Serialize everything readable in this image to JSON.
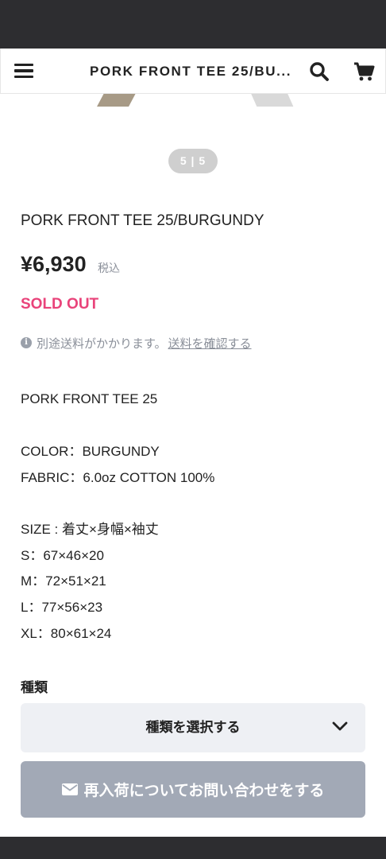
{
  "header": {
    "title": "PORK FRONT TEE 25/BU...",
    "menu_icon": "menu-icon",
    "search_icon": "search-icon",
    "cart_icon": "cart-icon"
  },
  "gallery": {
    "counter": "5 | 5"
  },
  "product": {
    "name": "PORK FRONT TEE 25/BURGUNDY",
    "price": "¥6,930",
    "tax_label": "税込",
    "status": "SOLD OUT",
    "status_color": "#e9437a"
  },
  "shipping": {
    "note": "別途送料がかかります。",
    "link": "送料を確認する"
  },
  "description": [
    "PORK FRONT TEE 25",
    "COLOR：BURGUNDY",
    "FABRIC：6.0oz COTTON 100%",
    "SIZE : 着丈×身幅×袖丈",
    "S：67×46×20",
    "M：72×51×21",
    "L：77×56×23",
    "XL：80×61×24"
  ],
  "variant": {
    "label": "種類",
    "placeholder": "種類を選択する"
  },
  "restock_button": {
    "label": "再入荷についてお問い合わせをする",
    "color": "#a2a9b6"
  }
}
